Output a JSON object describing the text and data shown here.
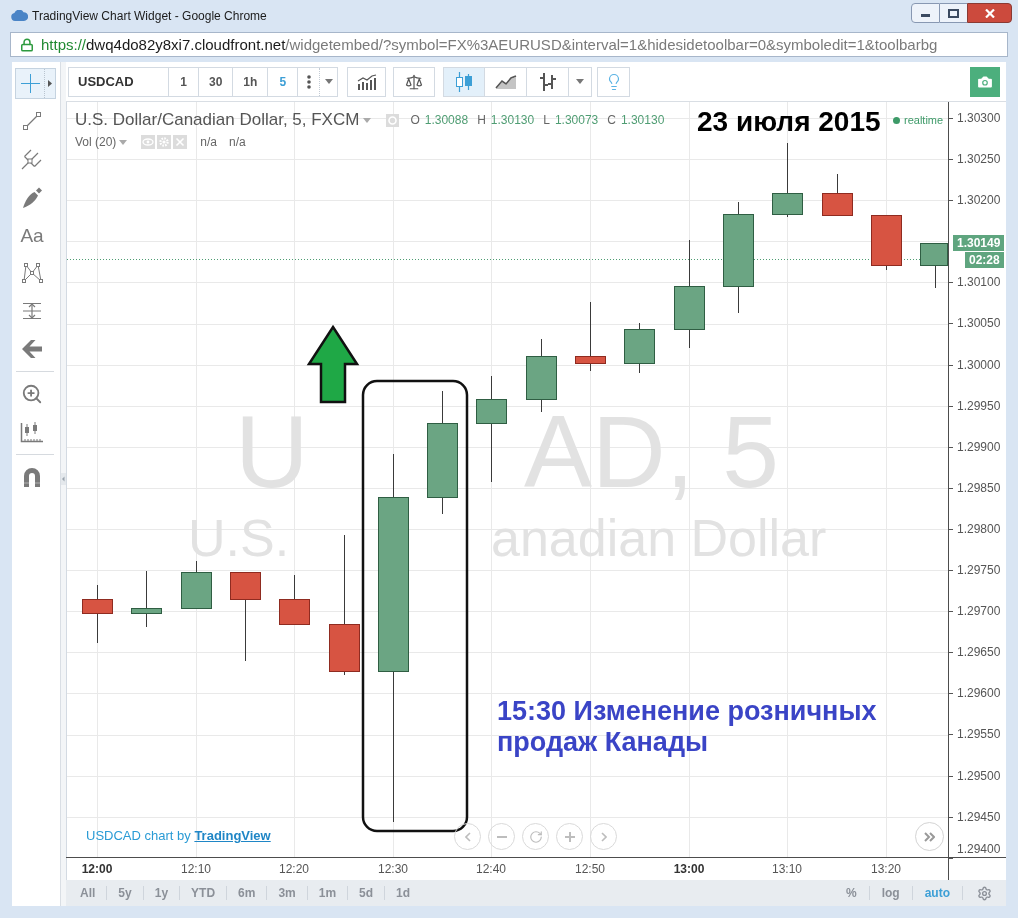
{
  "window": {
    "title": "TradingView Chart Widget - Google Chrome"
  },
  "address_bar": {
    "scheme": "https://",
    "host": "dwq4do82y8xi7.cloudfront.net",
    "path": "/widgetembed/?symbol=FX%3AEURUSD&interval=1&hidesidetoolbar=0&symboledit=1&toolbarbg"
  },
  "drawing_toolbar": {
    "groups": [
      {
        "tools": [
          {
            "kind": "crosshair",
            "selected": true
          },
          {
            "kind": "trend_line",
            "selected": false
          },
          {
            "kind": "pitchfork",
            "selected": false
          },
          {
            "kind": "brush",
            "selected": false
          },
          {
            "kind": "text",
            "label": "Aa",
            "selected": false
          },
          {
            "kind": "pattern",
            "selected": false
          },
          {
            "kind": "measure",
            "selected": false
          },
          {
            "kind": "remove",
            "selected": false
          }
        ]
      },
      {
        "tools": [
          {
            "kind": "zoom",
            "selected": false
          },
          {
            "kind": "ruler",
            "selected": false
          }
        ]
      },
      {
        "tools": [
          {
            "kind": "magnet",
            "selected": false
          }
        ]
      }
    ]
  },
  "toolbar": {
    "symbol": "USDCAD",
    "intervals": [
      {
        "label": "1",
        "selected": false
      },
      {
        "label": "30",
        "selected": false
      },
      {
        "label": "1h",
        "selected": false
      },
      {
        "label": "5",
        "selected": true
      }
    ],
    "chart_styles": [
      {
        "kind": "candles",
        "selected": true
      },
      {
        "kind": "line",
        "selected": false
      },
      {
        "kind": "bars",
        "selected": false
      }
    ]
  },
  "chart": {
    "legend": {
      "title": "U.S. Dollar/Canadian Dollar, 5, FXCM",
      "ohlc": [
        {
          "label": "O",
          "value": "1.30088"
        },
        {
          "label": "H",
          "value": "1.30130"
        },
        {
          "label": "L",
          "value": "1.30073"
        },
        {
          "label": "C",
          "value": "1.30130"
        }
      ],
      "volume": {
        "title": "Vol (20)",
        "values": [
          "n/a",
          "n/a"
        ]
      }
    },
    "date_annotation": "23 июля 2015",
    "status": "realtime",
    "symbol_backdrop": {
      "symbol_parts": [
        "U",
        "AD, 5"
      ],
      "description_parts": [
        "U.S.",
        "anadian Dollar"
      ]
    },
    "news_annotation": "15:30 Изменение розничных продаж Канады",
    "attribution": {
      "text": "USDCAD chart by",
      "link": "TradingView"
    }
  },
  "price_axis": {
    "ticks": [
      "1.30300",
      "1.30250",
      "1.30200",
      "1.30100",
      "1.30050",
      "1.30000",
      "1.29950",
      "1.29900",
      "1.29850",
      "1.29800",
      "1.29750",
      "1.29700",
      "1.29650",
      "1.29600",
      "1.29550",
      "1.29500",
      "1.29450",
      "1.29400"
    ],
    "last_price": "1.30149",
    "countdown": "02:28"
  },
  "time_axis": {
    "ticks": [
      {
        "label": "12:00",
        "major": true
      },
      {
        "label": "12:10",
        "major": false
      },
      {
        "label": "12:20",
        "major": false
      },
      {
        "label": "12:30",
        "major": false
      },
      {
        "label": "12:40",
        "major": false
      },
      {
        "label": "12:50",
        "major": false
      },
      {
        "label": "13:00",
        "major": true
      },
      {
        "label": "13:10",
        "major": false
      },
      {
        "label": "13:20",
        "major": false
      }
    ]
  },
  "bottom_bar": {
    "ranges": [
      {
        "label": "All",
        "selected": false
      },
      {
        "label": "5y",
        "selected": false
      },
      {
        "label": "1y",
        "selected": false
      },
      {
        "label": "YTD",
        "selected": false
      },
      {
        "label": "6m",
        "selected": false
      },
      {
        "label": "3m",
        "selected": false
      },
      {
        "label": "1m",
        "selected": false
      },
      {
        "label": "5d",
        "selected": false
      },
      {
        "label": "1d",
        "selected": false
      }
    ],
    "scale_options": [
      {
        "label": "%",
        "selected": false
      },
      {
        "label": "log",
        "selected": false
      },
      {
        "label": "auto",
        "selected": true
      }
    ]
  }
}
